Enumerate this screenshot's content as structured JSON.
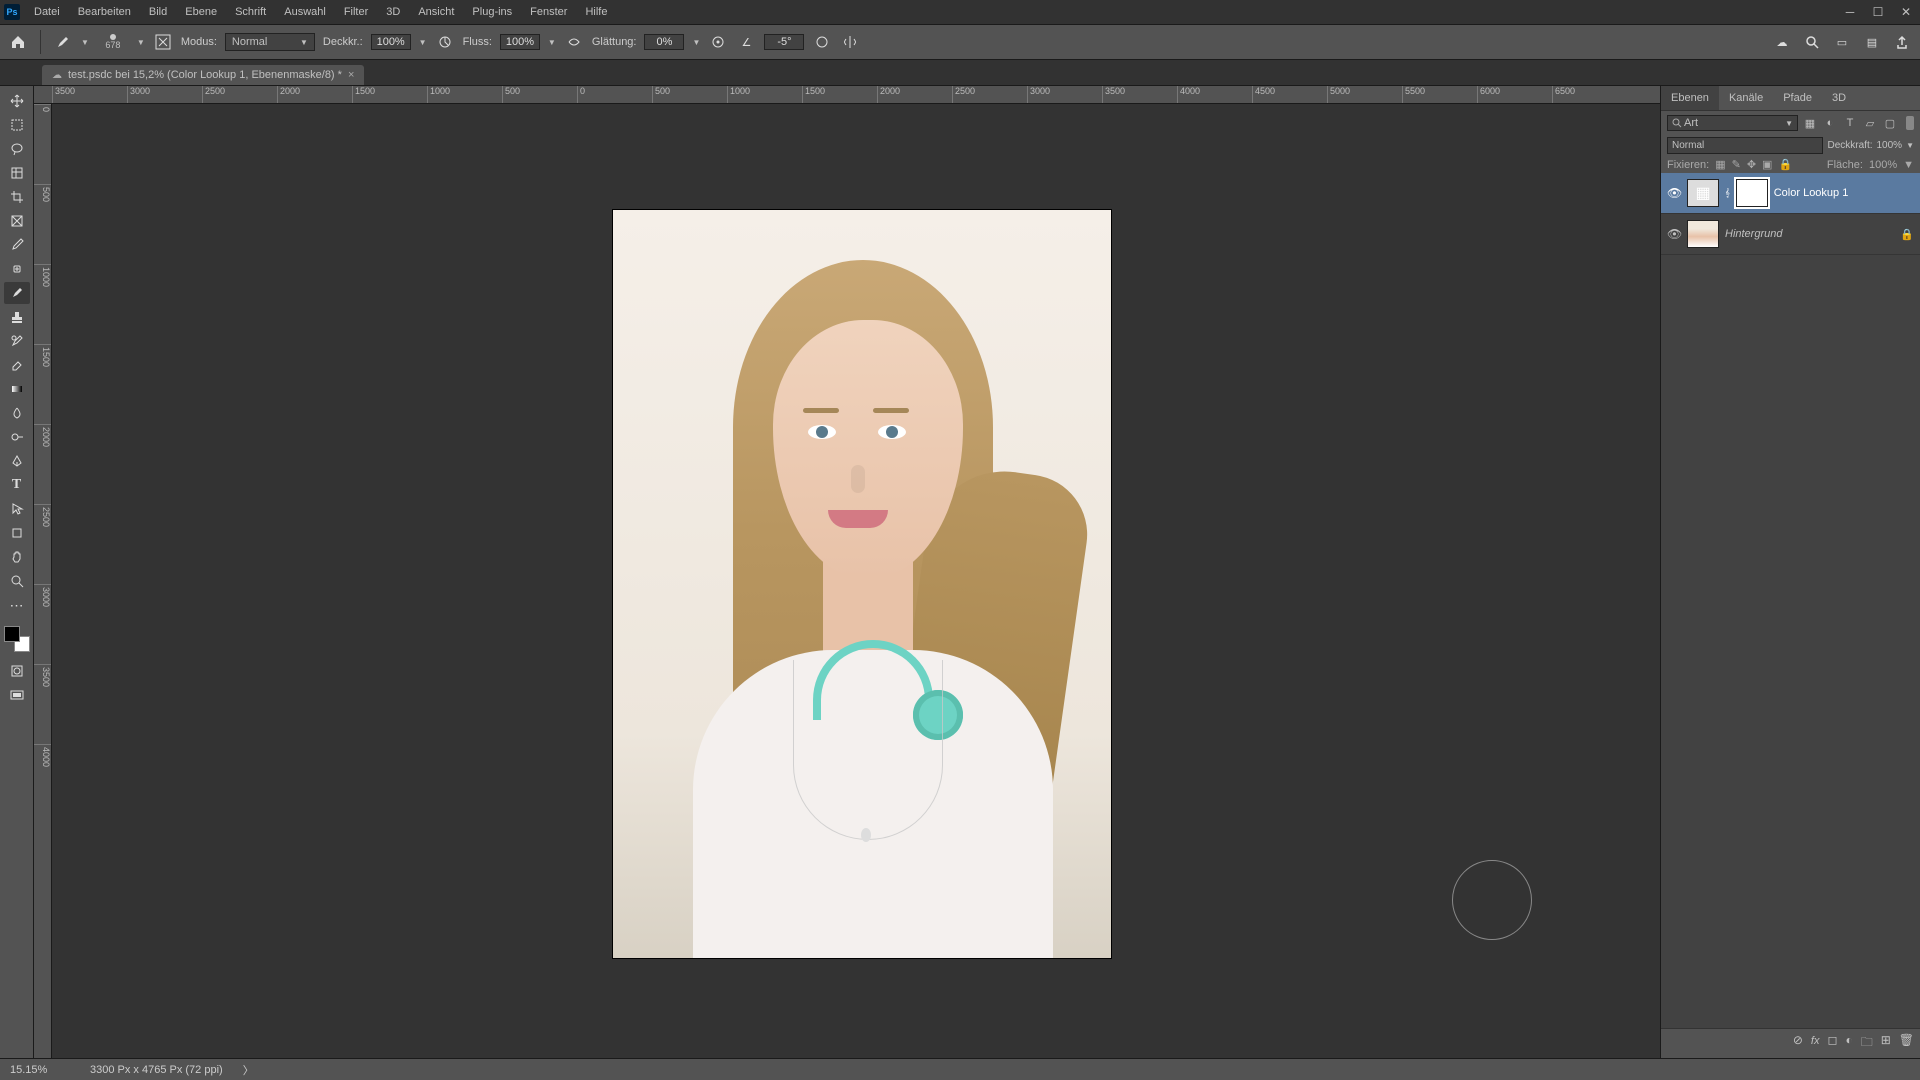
{
  "menubar": [
    "Datei",
    "Bearbeiten",
    "Bild",
    "Ebene",
    "Schrift",
    "Auswahl",
    "Filter",
    "3D",
    "Ansicht",
    "Plug-ins",
    "Fenster",
    "Hilfe"
  ],
  "options": {
    "brush_size": "678",
    "mode_label": "Modus:",
    "mode_value": "Normal",
    "opacity_label": "Deckkr.:",
    "opacity_value": "100%",
    "flow_label": "Fluss:",
    "flow_value": "100%",
    "smoothing_label": "Glättung:",
    "smoothing_value": "0%",
    "angle_value": "-5°"
  },
  "doctab": {
    "title": "test.psdc bei 15,2% (Color Lookup 1, Ebenenmaske/8) *"
  },
  "ruler_h": [
    "-3500",
    "-3000",
    "-2500",
    "-2000",
    "-1500",
    "-1000",
    "-500",
    "0",
    "500",
    "1000",
    "1500",
    "2000",
    "2500",
    "3000",
    "3500",
    "4000",
    "4500",
    "5000",
    "5500",
    "6000",
    "6500"
  ],
  "ruler_v": [
    "0",
    "500",
    "1000",
    "1500",
    "2000",
    "2500",
    "3000",
    "3500",
    "4000"
  ],
  "panels": {
    "tabs": [
      "Ebenen",
      "Kanäle",
      "Pfade",
      "3D"
    ],
    "kind_label": "Art",
    "blend_mode": "Normal",
    "opacity_label": "Deckkraft:",
    "opacity_value": "100%",
    "lock_label": "Fixieren:",
    "fill_label": "Fläche:",
    "fill_value": "100%",
    "layers": [
      {
        "name": "Color Lookup 1",
        "locked": false,
        "type": "adjustment",
        "selected": true
      },
      {
        "name": "Hintergrund",
        "locked": true,
        "type": "image",
        "selected": false
      }
    ]
  },
  "status": {
    "zoom": "15.15%",
    "docinfo": "3300 Px x 4765 Px (72 ppi)"
  }
}
